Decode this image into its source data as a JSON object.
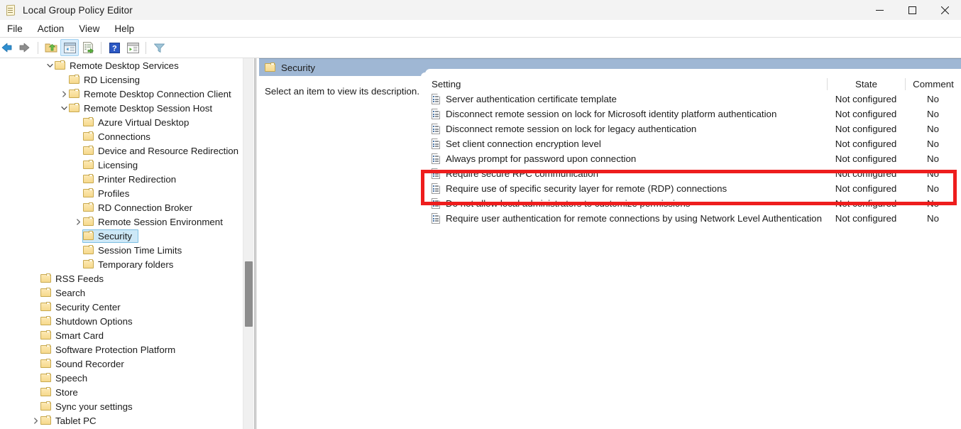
{
  "window": {
    "title": "Local Group Policy Editor",
    "icon": "gpedit-icon",
    "controls": [
      {
        "name": "minimize-button",
        "glyph": "minimize"
      },
      {
        "name": "maximize-button",
        "glyph": "maximize"
      },
      {
        "name": "close-button",
        "glyph": "close"
      }
    ]
  },
  "menubar": {
    "items": [
      {
        "label": "File",
        "name": "menu-file"
      },
      {
        "label": "Action",
        "name": "menu-action"
      },
      {
        "label": "View",
        "name": "menu-view"
      },
      {
        "label": "Help",
        "name": "menu-help"
      }
    ]
  },
  "toolbar": {
    "buttons": [
      {
        "name": "back-button",
        "icon": "back-arrow-icon",
        "active": false
      },
      {
        "name": "forward-button",
        "icon": "forward-arrow-icon",
        "active": false
      },
      {
        "name": "up-one-level-button",
        "icon": "folder-up-icon",
        "active": false
      },
      {
        "name": "show-hide-console-tree-button",
        "icon": "console-tree-icon",
        "active": true
      },
      {
        "name": "export-list-button",
        "icon": "export-list-icon",
        "active": false
      },
      {
        "name": "help-button",
        "icon": "help-question-icon",
        "active": false
      },
      {
        "name": "show-hide-action-pane-button",
        "icon": "action-pane-icon",
        "active": false
      },
      {
        "name": "filter-button",
        "icon": "filter-funnel-icon",
        "active": false
      }
    ]
  },
  "tree": {
    "items": [
      {
        "label": "Remote Desktop Services",
        "indent": 3,
        "twisty": "down"
      },
      {
        "label": "RD Licensing",
        "indent": 4,
        "twisty": "none"
      },
      {
        "label": "Remote Desktop Connection Client",
        "indent": 4,
        "twisty": "right"
      },
      {
        "label": "Remote Desktop Session Host",
        "indent": 4,
        "twisty": "down"
      },
      {
        "label": "Azure Virtual Desktop",
        "indent": 5,
        "twisty": "none"
      },
      {
        "label": "Connections",
        "indent": 5,
        "twisty": "none"
      },
      {
        "label": "Device and Resource Redirection",
        "indent": 5,
        "twisty": "none"
      },
      {
        "label": "Licensing",
        "indent": 5,
        "twisty": "none"
      },
      {
        "label": "Printer Redirection",
        "indent": 5,
        "twisty": "none"
      },
      {
        "label": "Profiles",
        "indent": 5,
        "twisty": "none"
      },
      {
        "label": "RD Connection Broker",
        "indent": 5,
        "twisty": "none"
      },
      {
        "label": "Remote Session Environment",
        "indent": 5,
        "twisty": "right"
      },
      {
        "label": "Security",
        "indent": 5,
        "twisty": "none",
        "selected": true
      },
      {
        "label": "Session Time Limits",
        "indent": 5,
        "twisty": "none"
      },
      {
        "label": "Temporary folders",
        "indent": 5,
        "twisty": "none"
      },
      {
        "label": "RSS Feeds",
        "indent": 2,
        "twisty": "none"
      },
      {
        "label": "Search",
        "indent": 2,
        "twisty": "none"
      },
      {
        "label": "Security Center",
        "indent": 2,
        "twisty": "none"
      },
      {
        "label": "Shutdown Options",
        "indent": 2,
        "twisty": "none"
      },
      {
        "label": "Smart Card",
        "indent": 2,
        "twisty": "none"
      },
      {
        "label": "Software Protection Platform",
        "indent": 2,
        "twisty": "none"
      },
      {
        "label": "Sound Recorder",
        "indent": 2,
        "twisty": "none"
      },
      {
        "label": "Speech",
        "indent": 2,
        "twisty": "none"
      },
      {
        "label": "Store",
        "indent": 2,
        "twisty": "none"
      },
      {
        "label": "Sync your settings",
        "indent": 2,
        "twisty": "none"
      },
      {
        "label": "Tablet PC",
        "indent": 2,
        "twisty": "right"
      }
    ]
  },
  "right_pane": {
    "header_title": "Security",
    "description": "Select an item to view its description.",
    "columns": {
      "setting": "Setting",
      "state": "State",
      "comment": "Comment"
    },
    "rows": [
      {
        "setting": "Server authentication certificate template",
        "state": "Not configured",
        "comment": "No"
      },
      {
        "setting": "Disconnect remote session on lock for Microsoft identity platform authentication",
        "state": "Not configured",
        "comment": "No"
      },
      {
        "setting": "Disconnect remote session on lock for legacy authentication",
        "state": "Not configured",
        "comment": "No"
      },
      {
        "setting": "Set client connection encryption level",
        "state": "Not configured",
        "comment": "No"
      },
      {
        "setting": "Always prompt for password upon connection",
        "state": "Not configured",
        "comment": "No"
      },
      {
        "setting": "Require secure RPC communication",
        "state": "Not configured",
        "comment": "No"
      },
      {
        "setting": "Require use of specific security layer for remote (RDP) connections",
        "state": "Not configured",
        "comment": "No"
      },
      {
        "setting": "Do not allow local administrators to customize permissions",
        "state": "Not configured",
        "comment": "No"
      },
      {
        "setting": "Require user authentication for remote connections by using Network Level Authentication",
        "state": "Not configured",
        "comment": "No"
      }
    ]
  },
  "annotation": {
    "type": "highlight-rectangle",
    "color": "#ee1d1d",
    "covers_rows": [
      1,
      2
    ]
  },
  "colors": {
    "header_bar": "#9fb7d4",
    "selection": "#cde8f7",
    "annotation": "#ee1d1d",
    "titlebar": "#f3f3f3"
  }
}
